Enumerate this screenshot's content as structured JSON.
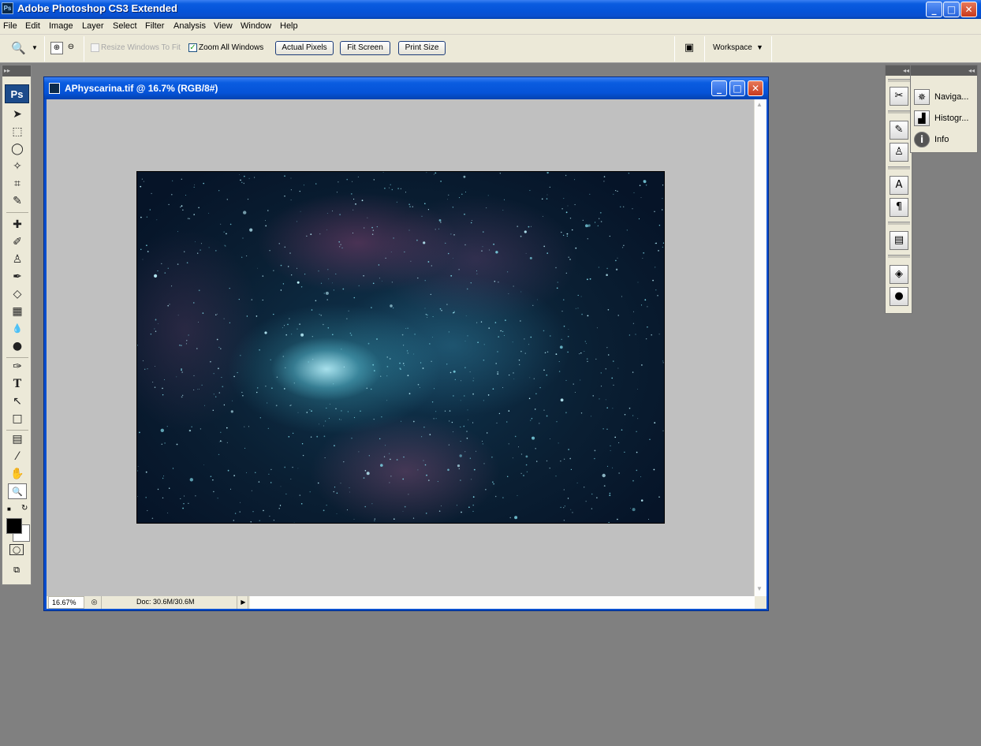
{
  "app": {
    "title": "Adobe Photoshop CS3 Extended",
    "icon_label": "Ps"
  },
  "menu": [
    "File",
    "Edit",
    "Image",
    "Layer",
    "Select",
    "Filter",
    "Analysis",
    "View",
    "Window",
    "Help"
  ],
  "options": {
    "resize_windows_label": "Resize Windows To Fit",
    "resize_windows_checked": false,
    "zoom_all_label": "Zoom All Windows",
    "zoom_all_checked": true,
    "actual_pixels": "Actual Pixels",
    "fit_screen": "Fit Screen",
    "print_size": "Print Size",
    "workspace": "Workspace"
  },
  "tools": {
    "logo": "Ps",
    "items": [
      {
        "name": "move-tool",
        "glyph": "➤"
      },
      {
        "name": "marquee-tool",
        "glyph": "⬚"
      },
      {
        "name": "lasso-tool",
        "glyph": "◯"
      },
      {
        "name": "magic-wand-tool",
        "glyph": "✧"
      },
      {
        "name": "crop-tool",
        "glyph": "⌗"
      },
      {
        "name": "slice-tool",
        "glyph": "✎"
      },
      {
        "name": "healing-brush-tool",
        "glyph": "✚"
      },
      {
        "name": "brush-tool",
        "glyph": "✐"
      },
      {
        "name": "clone-stamp-tool",
        "glyph": "♙"
      },
      {
        "name": "history-brush-tool",
        "glyph": "✒"
      },
      {
        "name": "eraser-tool",
        "glyph": "◇"
      },
      {
        "name": "gradient-tool",
        "glyph": "▦"
      },
      {
        "name": "blur-tool",
        "glyph": "💧"
      },
      {
        "name": "dodge-tool",
        "glyph": "●"
      },
      {
        "name": "pen-tool",
        "glyph": "✑"
      },
      {
        "name": "type-tool",
        "glyph": "T"
      },
      {
        "name": "path-selection-tool",
        "glyph": "↖"
      },
      {
        "name": "shape-tool",
        "glyph": "□"
      },
      {
        "name": "notes-tool",
        "glyph": "▤"
      },
      {
        "name": "eyedropper-tool",
        "glyph": "⁄"
      },
      {
        "name": "hand-tool",
        "glyph": "✋"
      },
      {
        "name": "zoom-tool",
        "glyph": "🔍"
      }
    ]
  },
  "document": {
    "title": "APhyscarina.tif @ 16.7% (RGB/8#)",
    "zoom": "16.67%",
    "doc_size": "Doc: 30.6M/30.6M"
  },
  "panels": {
    "navigator": "Naviga...",
    "histogram": "Histogr...",
    "info": "Info"
  }
}
